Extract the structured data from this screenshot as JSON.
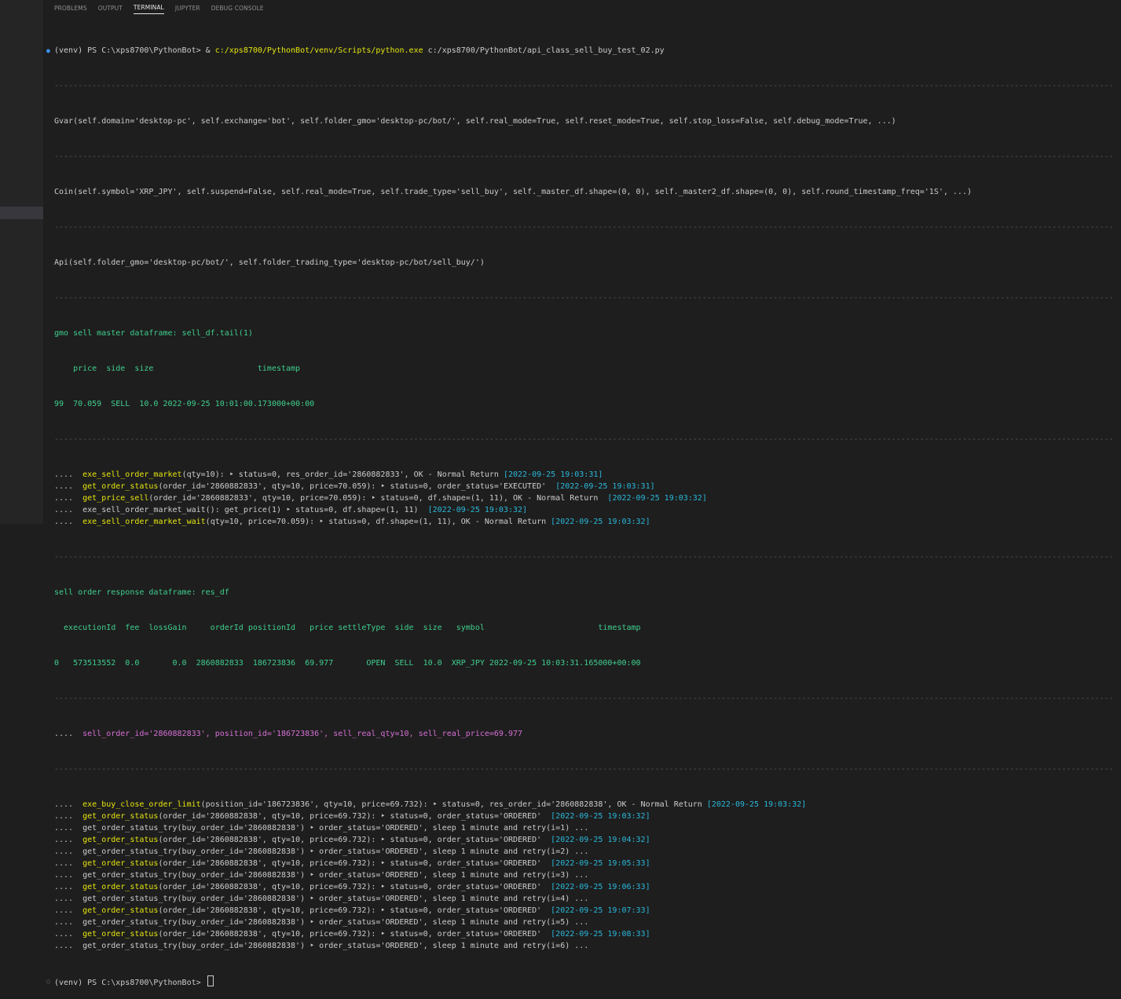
{
  "panel": {
    "tabs": [
      "PROBLEMS",
      "OUTPUT",
      "TERMINAL",
      "JUPYTER",
      "DEBUG CONSOLE"
    ],
    "active_tab": "TERMINAL"
  },
  "terminal": {
    "colors": {
      "green": "#3fcf8e",
      "yellow": "#e5e510",
      "cyan": "#29b8db",
      "magenta": "#d670d6",
      "plain": "#cccccc",
      "separator": "#555555"
    },
    "separator": "------------------------------------------------------------------------------------------------------------------------------------------------------------------------------------------------------------------------------------------------------",
    "prompt_cmd": {
      "prompt": "(venv) PS C:\\xps8700\\PythonBot> & ",
      "exe": "c:/xps8700/PythonBot/venv/Scripts/python.exe",
      "script": " c:/xps8700/PythonBot/api_class_sell_buy_test_02.py"
    },
    "gvar": "Gvar(self.domain='desktop-pc', self.exchange='bot', self.folder_gmo='desktop-pc/bot/', self.real_mode=True, self.reset_mode=True, self.stop_loss=False, self.debug_mode=True, ...)",
    "coin": "Coin(self.symbol='XRP_JPY', self.suspend=False, self.real_mode=True, self.trade_type='sell_buy', self._master_df.shape=(0, 0), self._master2_df.shape=(0, 0), self.round_timestamp_freq='1S', ...)",
    "api": "Api(self.folder_gmo='desktop-pc/bot/', self.folder_trading_type='desktop-pc/bot/sell_buy/')",
    "master_title": "gmo sell master dataframe: sell_df.tail(1)",
    "master_header": "    price  side  size                      timestamp",
    "master_row": "99  70.059  SELL  10.0 2022-09-25 10:01:00.173000+00:00",
    "block1": [
      {
        "pre": "....  ",
        "name": "exe_sell_order_market",
        "rest": "(qty=10): ‣ status=0, res_order_id='2860882833', OK - Normal Return ",
        "ts": "[2022-09-25 19:03:31]",
        "post": ""
      },
      {
        "pre": "....  ",
        "name": "get_order_status",
        "rest": "(order_id='2860882833', qty=10, price=70.059): ‣ status=0, order_status='EXECUTED'  ",
        "ts": "[2022-09-25 19:03:31]",
        "post": ""
      },
      {
        "pre": "....  ",
        "name": "get_price_sell",
        "rest": "(order_id='2860882833', qty=10, price=70.059): ‣ status=0, df.shape=(1, 11), OK - Normal Return  ",
        "ts": "[2022-09-25 19:03:32]",
        "post": ""
      },
      {
        "pre": "....  ",
        "name": "",
        "rest": "exe_sell_order_market_wait(): get_price(1) ‣ status=0, df.shape=(1, 11)  ",
        "ts": "[2022-09-25 19:03:32]",
        "post": ""
      },
      {
        "pre": "....  ",
        "name": "exe_sell_order_market_wait",
        "rest": "(qty=10, price=70.059): ‣ status=0, df.shape=(1, 11), OK - Normal Return ",
        "ts": "[2022-09-25 19:03:32]",
        "post": ""
      }
    ],
    "res_title": "sell order response dataframe: res_df",
    "res_header": "  executionId  fee  lossGain     orderId positionId   price settleType  side  size   symbol                        timestamp",
    "res_row": "0   573513552  0.0       0.0  2860882833  186723836  69.977       OPEN  SELL  10.0  XRP_JPY 2022-09-25 10:03:31.165000+00:00",
    "sell_line_pre": "....  ",
    "sell_line": "sell_order_id='2860882833', position_id='186723836', sell_real_qty=10, sell_real_price=69.977",
    "block2": [
      {
        "pre": "....  ",
        "name": "exe_buy_close_order_limit",
        "rest": "(position_id='186723836', qty=10, price=69.732): ‣ status=0, res_order_id='2860882838', OK - Normal Return ",
        "ts": "[2022-09-25 19:03:32]",
        "post": ""
      },
      {
        "pre": "....  ",
        "name": "get_order_status",
        "rest": "(order_id='2860882838', qty=10, price=69.732): ‣ status=0, order_status='ORDERED'  ",
        "ts": "[2022-09-25 19:03:32]",
        "post": ""
      },
      {
        "pre": "....  ",
        "name": "",
        "rest": "get_order_status_try(buy_order_id='2860882838') ‣ order_status='ORDERED', sleep 1 minute and retry(i=1) ...",
        "ts": "",
        "post": ""
      },
      {
        "pre": "....  ",
        "name": "get_order_status",
        "rest": "(order_id='2860882838', qty=10, price=69.732): ‣ status=0, order_status='ORDERED'  ",
        "ts": "[2022-09-25 19:04:32]",
        "post": ""
      },
      {
        "pre": "....  ",
        "name": "",
        "rest": "get_order_status_try(buy_order_id='2860882838') ‣ order_status='ORDERED', sleep 1 minute and retry(i=2) ...",
        "ts": "",
        "post": ""
      },
      {
        "pre": "....  ",
        "name": "get_order_status",
        "rest": "(order_id='2860882838', qty=10, price=69.732): ‣ status=0, order_status='ORDERED'  ",
        "ts": "[2022-09-25 19:05:33]",
        "post": ""
      },
      {
        "pre": "....  ",
        "name": "",
        "rest": "get_order_status_try(buy_order_id='2860882838') ‣ order_status='ORDERED', sleep 1 minute and retry(i=3) ...",
        "ts": "",
        "post": ""
      },
      {
        "pre": "....  ",
        "name": "get_order_status",
        "rest": "(order_id='2860882838', qty=10, price=69.732): ‣ status=0, order_status='ORDERED'  ",
        "ts": "[2022-09-25 19:06:33]",
        "post": ""
      },
      {
        "pre": "....  ",
        "name": "",
        "rest": "get_order_status_try(buy_order_id='2860882838') ‣ order_status='ORDERED', sleep 1 minute and retry(i=4) ...",
        "ts": "",
        "post": ""
      },
      {
        "pre": "....  ",
        "name": "get_order_status",
        "rest": "(order_id='2860882838', qty=10, price=69.732): ‣ status=0, order_status='ORDERED'  ",
        "ts": "[2022-09-25 19:07:33]",
        "post": ""
      },
      {
        "pre": "....  ",
        "name": "",
        "rest": "get_order_status_try(buy_order_id='2860882838') ‣ order_status='ORDERED', sleep 1 minute and retry(i=5) ...",
        "ts": "",
        "post": ""
      },
      {
        "pre": "....  ",
        "name": "get_order_status",
        "rest": "(order_id='2860882838', qty=10, price=69.732): ‣ status=0, order_status='ORDERED'  ",
        "ts": "[2022-09-25 19:08:33]",
        "post": ""
      },
      {
        "pre": "....  ",
        "name": "",
        "rest": "get_order_status_try(buy_order_id='2860882838') ‣ order_status='ORDERED', sleep 1 minute and retry(i=6) ...",
        "ts": "",
        "post": ""
      }
    ],
    "final_prompt": "(venv) PS C:\\xps8700\\PythonBot> "
  }
}
